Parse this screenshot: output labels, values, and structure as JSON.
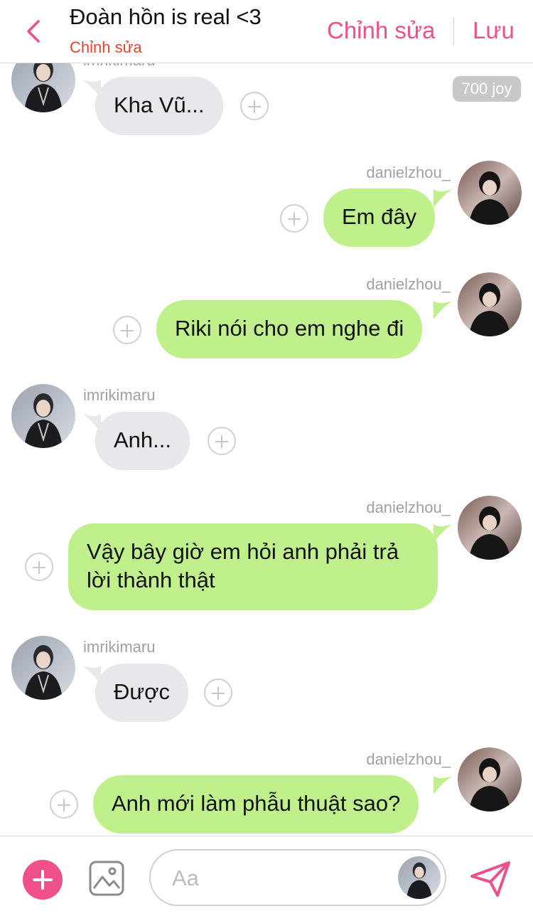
{
  "header": {
    "title": "Đoàn hồn is real <3",
    "subtitle": "Chỉnh sửa",
    "edit_label": "Chỉnh sửa",
    "save_label": "Lưu",
    "accent_color": "#f0508a"
  },
  "badge": {
    "joy": "700 joy"
  },
  "messages": [
    {
      "sender": "imrikimaru",
      "direction": "incoming",
      "text": "Kha Vũ..."
    },
    {
      "sender": "danielzhou_",
      "direction": "outgoing",
      "text": "Em đây"
    },
    {
      "sender": "danielzhou_",
      "direction": "outgoing",
      "text": "Riki nói cho em nghe đi"
    },
    {
      "sender": "imrikimaru",
      "direction": "incoming",
      "text": "Anh..."
    },
    {
      "sender": "danielzhou_",
      "direction": "outgoing",
      "text": "Vậy bây giờ em hỏi anh phải trả lời thành thật"
    },
    {
      "sender": "imrikimaru",
      "direction": "incoming",
      "text": "Được"
    },
    {
      "sender": "danielzhou_",
      "direction": "outgoing",
      "text": "Anh mới làm phẫu thuật sao?"
    }
  ],
  "composer": {
    "placeholder": "Aa",
    "add_icon": "plus-icon",
    "image_icon": "image-icon",
    "send_icon": "send-icon"
  },
  "colors": {
    "incoming_bubble": "#e6e8eb",
    "outgoing_bubble": "#c0f08c",
    "username": "#a0a0a0"
  }
}
